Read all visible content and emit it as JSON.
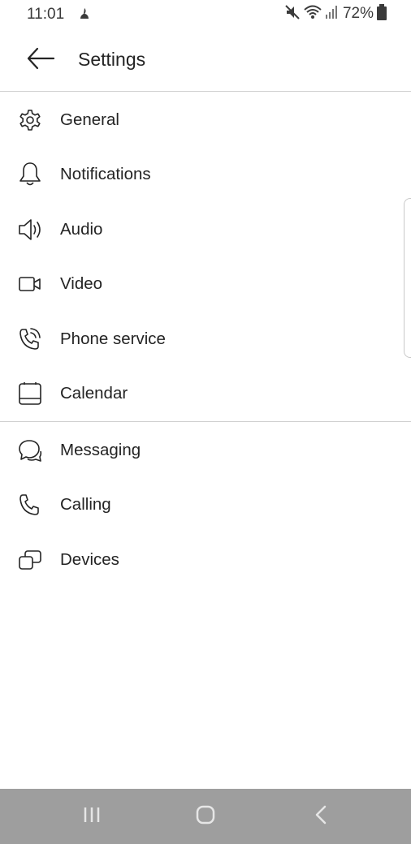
{
  "status_bar": {
    "time": "11:01",
    "battery_text": "72%",
    "icons": [
      "notification-icon",
      "mute-icon",
      "wifi-icon",
      "signal-icon",
      "battery-icon"
    ]
  },
  "app_bar": {
    "back_icon": "back-arrow-icon",
    "title": "Settings"
  },
  "menu_group_1": {
    "items": [
      {
        "label": "General",
        "icon": "gear-icon"
      },
      {
        "label": "Notifications",
        "icon": "bell-icon"
      },
      {
        "label": "Audio",
        "icon": "speaker-icon"
      },
      {
        "label": "Video",
        "icon": "video-camera-icon"
      },
      {
        "label": "Phone service",
        "icon": "phone-ring-icon"
      },
      {
        "label": "Calendar",
        "icon": "calendar-icon"
      }
    ]
  },
  "menu_group_2": {
    "items": [
      {
        "label": "Messaging",
        "icon": "chat-icon"
      },
      {
        "label": "Calling",
        "icon": "phone-icon"
      },
      {
        "label": "Devices",
        "icon": "devices-icon"
      }
    ]
  },
  "nav_bar": {
    "buttons": [
      "recent-apps-icon",
      "home-icon",
      "back-icon"
    ]
  }
}
